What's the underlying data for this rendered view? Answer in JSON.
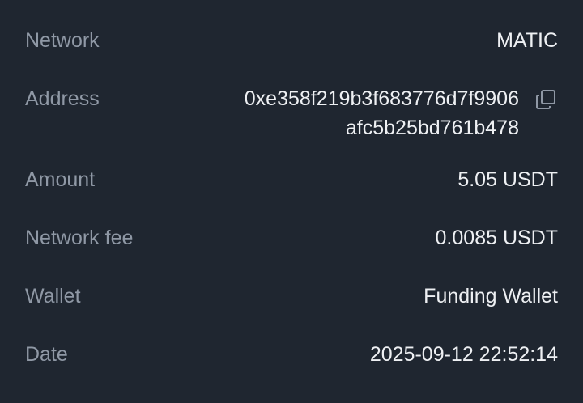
{
  "details": {
    "network": {
      "label": "Network",
      "value": "MATIC"
    },
    "address": {
      "label": "Address",
      "line1": "0xe358f219b3f683776d7f9906",
      "line2": "afc5b25bd761b478",
      "copy_icon": "copy-icon"
    },
    "amount": {
      "label": "Amount",
      "value": "5.05 USDT"
    },
    "network_fee": {
      "label": "Network fee",
      "value": "0.0085 USDT"
    },
    "wallet": {
      "label": "Wallet",
      "value": "Funding Wallet"
    },
    "date": {
      "label": "Date",
      "value": "2025-09-12 22:52:14"
    }
  },
  "colors": {
    "background": "#1f2630",
    "label": "#8f98a5",
    "value": "#eef0f3",
    "icon": "#8f98a5"
  }
}
